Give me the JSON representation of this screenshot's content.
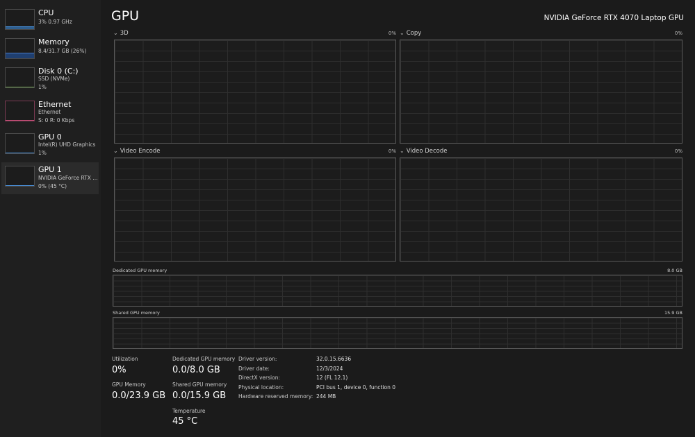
{
  "sidebar": {
    "items": [
      {
        "title": "CPU",
        "sub1": "3%  0.97 GHz",
        "sub2": "",
        "color": "#4a90d9"
      },
      {
        "title": "Memory",
        "sub1": "8.4/31.7 GB (26%)",
        "sub2": "",
        "color": "#4a7cc9"
      },
      {
        "title": "Disk 0 (C:)",
        "sub1": "SSD (NVMe)",
        "sub2": "1%",
        "color": "#6a9a4a"
      },
      {
        "title": "Ethernet",
        "sub1": "Ethernet",
        "sub2": "S: 0  R: 0 Kbps",
        "color": "#c9507a"
      },
      {
        "title": "GPU 0",
        "sub1": "Intel(R) UHD Graphics",
        "sub2": "1%",
        "color": "#4a90d9"
      },
      {
        "title": "GPU 1",
        "sub1": "NVIDIA GeForce RTX ...",
        "sub2": "0%  (45 °C)",
        "color": "#4a90d9"
      }
    ]
  },
  "header": {
    "title": "GPU",
    "device": "NVIDIA GeForce RTX 4070 Laptop GPU"
  },
  "engines": [
    {
      "label": "3D",
      "pct": "0%"
    },
    {
      "label": "Copy",
      "pct": "0%"
    },
    {
      "label": "Video Encode",
      "pct": "0%"
    },
    {
      "label": "Video Decode",
      "pct": "0%"
    }
  ],
  "memory_graphs": {
    "dedicated": {
      "label": "Dedicated GPU memory",
      "max": "8.0 GB"
    },
    "shared": {
      "label": "Shared GPU memory",
      "max": "15.9 GB"
    }
  },
  "stats": {
    "utilization_label": "Utilization",
    "utilization_value": "0%",
    "dedicated_label": "Dedicated GPU memory",
    "dedicated_value": "0.0/8.0 GB",
    "gpu_memory_label": "GPU Memory",
    "gpu_memory_value": "0.0/23.9 GB",
    "shared_label": "Shared GPU memory",
    "shared_value": "0.0/15.9 GB",
    "temperature_label": "Temperature",
    "temperature_value": "45 °C"
  },
  "info": [
    {
      "key": "Driver version:",
      "value": "32.0.15.6636"
    },
    {
      "key": "Driver date:",
      "value": "12/3/2024"
    },
    {
      "key": "DirectX version:",
      "value": "12 (FL 12.1)"
    },
    {
      "key": "Physical location:",
      "value": "PCI bus 1, device 0, function 0"
    },
    {
      "key": "Hardware reserved memory:",
      "value": "244 MB"
    }
  ]
}
